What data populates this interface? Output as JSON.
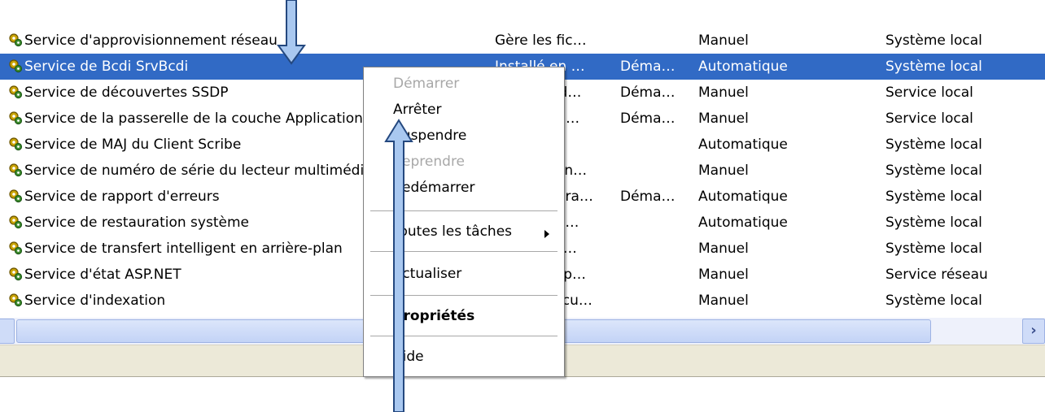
{
  "services": [
    {
      "name": "Service d'approvisionnement réseau",
      "description": "Gère les fic…",
      "status": "",
      "startup": "Manuel",
      "account": "Système local"
    },
    {
      "name": "Service de Bcdi SrvBcdi",
      "description": "Installé en …",
      "status": "Déma…",
      "startup": "Automatique",
      "account": "Système local",
      "selected": true
    },
    {
      "name": "Service de découvertes SSDP",
      "description": "Active la d…",
      "status": "Déma…",
      "startup": "Manuel",
      "account": "Service local"
    },
    {
      "name": "Service de la passerelle de la couche Application",
      "description": "Fournit pri…",
      "status": "Déma…",
      "startup": "Manuel",
      "account": "Service local"
    },
    {
      "name": "Service de MAJ du Client Scribe",
      "description": "",
      "status": "",
      "startup": "Automatique",
      "account": "Système local"
    },
    {
      "name": "Service de numéro de série du lecteur multimédia portable",
      "description": "Récupère n…",
      "status": "",
      "startup": "Manuel",
      "account": "Système local"
    },
    {
      "name": "Service de rapport d'erreurs",
      "description": "Permet le ra…",
      "status": "Déma…",
      "startup": "Automatique",
      "account": "Système local"
    },
    {
      "name": "Service de restauration système",
      "description": "Effectue d…",
      "status": "",
      "startup": "Automatique",
      "account": "Système local"
    },
    {
      "name": "Service de transfert intelligent en arrière-plan",
      "description": "Transfère …",
      "status": "",
      "startup": "Manuel",
      "account": "Système local"
    },
    {
      "name": "Service d'état ASP.NET",
      "description": "Fournit sup…",
      "status": "",
      "startup": "Manuel",
      "account": "Service réseau"
    },
    {
      "name": "Service d'indexation",
      "description": "Indexe le cu…",
      "status": "",
      "startup": "Manuel",
      "account": "Système local"
    }
  ],
  "context_menu": {
    "start": "Démarrer",
    "stop": "Arrêter",
    "pause": "Suspendre",
    "resume": "Reprendre",
    "restart": "Redémarrer",
    "all_tasks": "Toutes les tâches",
    "refresh": "Actualiser",
    "properties": "Propriétés",
    "help": "Aide"
  },
  "scrollbar": {
    "left_icon": "chevron-left-icon",
    "right_icon": "chevron-right-icon",
    "right_glyph": "›"
  },
  "colors": {
    "selection": "#316ac5",
    "arrow_fill": "#a9c8f0",
    "arrow_stroke": "#24487f"
  }
}
